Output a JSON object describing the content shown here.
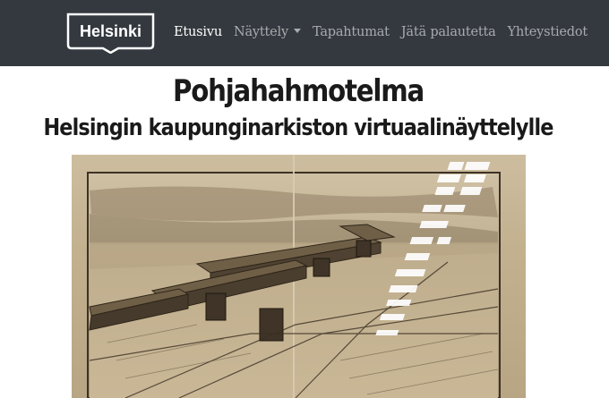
{
  "header": {
    "logo_text": "Helsinki",
    "nav": [
      {
        "label": "Etusivu",
        "active": true
      },
      {
        "label": "Näyttely",
        "dropdown": true
      },
      {
        "label": "Tapahtumat"
      },
      {
        "label": "Jätä palautetta"
      },
      {
        "label": "Yhteystiedot"
      }
    ]
  },
  "main": {
    "title": "Pohjahahmotelma",
    "subtitle": "Helsingin kaupunginarkiston virtuaalinäyttelylle"
  },
  "colors": {
    "navbar_bg": "#34393f",
    "nav_active": "#ffffff",
    "nav_inactive": "#a8abaf",
    "heading": "#1a1a1a"
  }
}
